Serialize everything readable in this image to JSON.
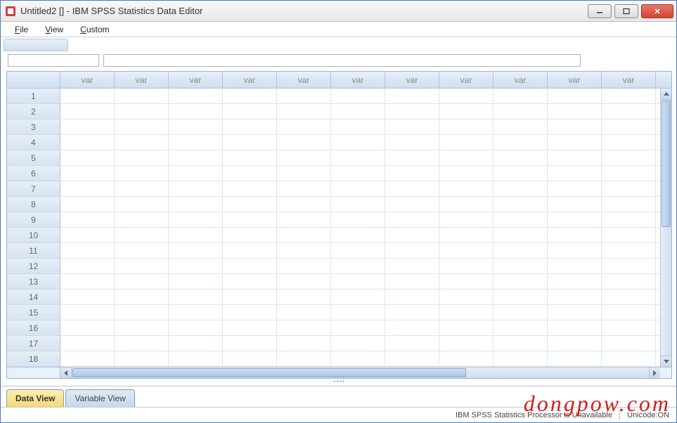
{
  "window": {
    "title": "Untitled2 [] - IBM SPSS Statistics Data Editor"
  },
  "menubar": {
    "items": [
      {
        "label": "File",
        "hotkey_pos": 0
      },
      {
        "label": "View",
        "hotkey_pos": 0
      },
      {
        "label": "Custom",
        "hotkey_pos": 0
      }
    ]
  },
  "grid": {
    "column_header_label": "var",
    "column_count": 11,
    "row_count": 18
  },
  "tabs": {
    "data_view": "Data View",
    "variable_view": "Variable View",
    "active": "data_view"
  },
  "statusbar": {
    "processor": "IBM SPSS Statistics Processor is Unavailable",
    "unicode": "Unicode:ON"
  },
  "watermark": "dongpow.com"
}
